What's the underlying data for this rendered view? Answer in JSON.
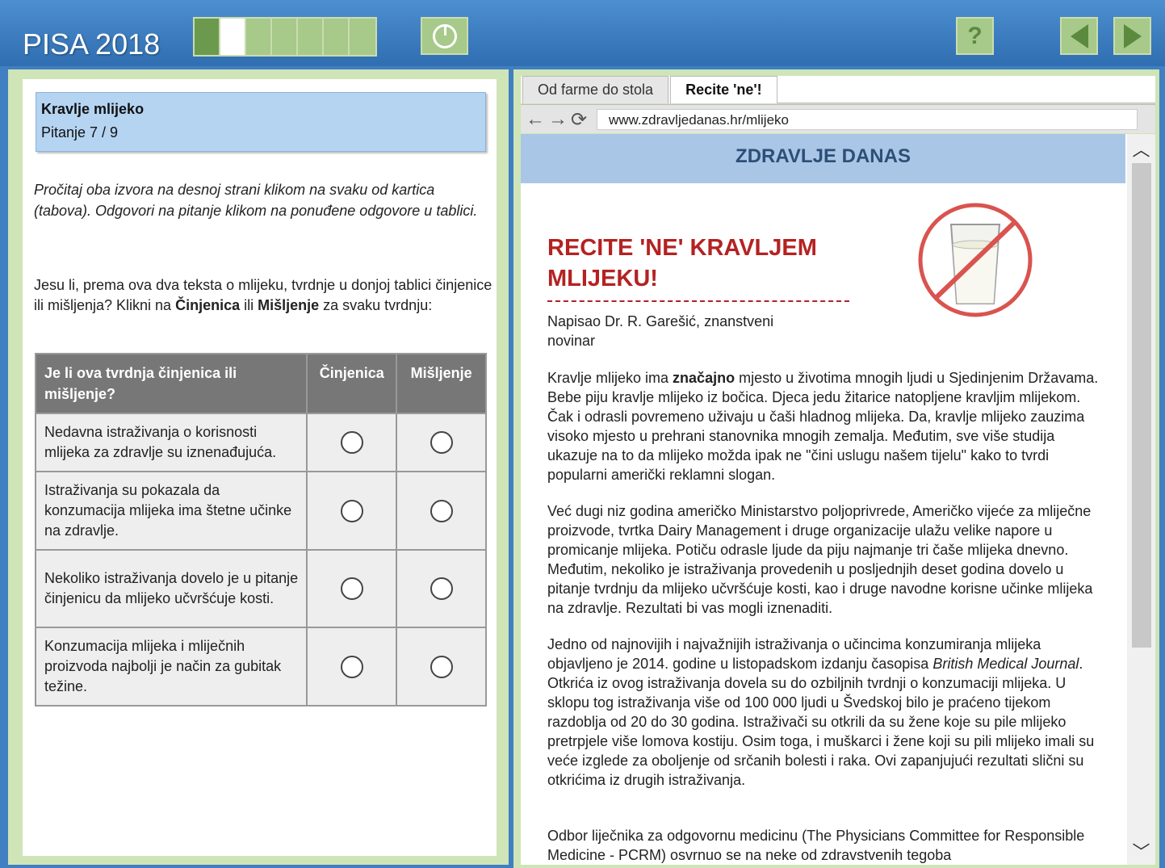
{
  "header": {
    "logo": "PISA 2018",
    "progress": {
      "total": 7,
      "done": 1,
      "current": 2
    },
    "help_label": "?"
  },
  "question_box": {
    "title": "Kravlje mlijeko",
    "subtitle": "Pitanje 7 / 9"
  },
  "instruction": "Pročitaj oba izvora na desnoj strani klikom na svaku od kartica (tabova). Odgovori na pitanje klikom na ponuđene odgovore u tablici.",
  "question": {
    "part1": "Jesu li, prema ova dva teksta o mlijeku, tvrdnje u donjoj tablici činjenice ili mišljenja? Klikni na ",
    "bold1": "Činjenica",
    "part2": " ili ",
    "bold2": "Mišljenje",
    "part3": " za svaku tvrdnju:"
  },
  "table": {
    "headers": [
      "Je li ova tvrdnja činjenica ili mišljenje?",
      "Činjenica",
      "Mišljenje"
    ],
    "rows": [
      "Nedavna istraživanja o korisnosti mlijeka za zdravlje su iznenađujuća.",
      "Istraživanja su pokazala da konzumacija mlijeka ima štetne učinke na zdravlje.",
      "Nekoliko istraživanja dovelo je u pitanje činjenicu da mlijeko učvršćuje kosti.",
      "Konzumacija mlijeka i mliječnih proizvoda najbolji je način za gubitak težine."
    ]
  },
  "browser": {
    "tabs": [
      "Od farme do stola",
      "Recite 'ne'!"
    ],
    "active_tab": 1,
    "url": "www.zdravljedanas.hr/mlijeko",
    "site_name": "ZDRAVLJE DANAS"
  },
  "article": {
    "title": "RECITE 'NE' KRAVLJEM MLIJEKU!",
    "byline": "Napisao Dr. R. Garešić, znanstveni novinar",
    "p1_a": "Kravlje mlijeko ima ",
    "p1_bold": "značajno",
    "p1_b": " mjesto u životima mnogih ljudi u Sjedinjenim Državama. Bebe piju kravlje mlijeko iz bočica. Djeca jedu žitarice natopljene kravljim mlijekom. Čak i odrasli povremeno uživaju u čaši hladnog mlijeka. Da, kravlje mlijeko zauzima visoko mjesto u prehrani stanovnika mnogih zemalja. Međutim, sve više studija ukazuje na to da mlijeko možda ipak ne \"čini uslugu našem tijelu\" kako to tvrdi popularni američki reklamni slogan.",
    "p2": "Već dugi niz godina američko Ministarstvo poljoprivrede, Američko vijeće za mliječne proizvode, tvrtka Dairy Management i druge organizacije ulažu velike napore u promicanje mlijeka. Potiču odrasle ljude da piju najmanje tri čaše mlijeka dnevno. Međutim, nekoliko je istraživanja provedenih u posljednjih deset godina dovelo u pitanje tvrdnju da mlijeko učvršćuje kosti, kao i druge navodne korisne učinke mlijeka na zdravlje. Rezultati bi vas mogli iznenaditi.",
    "p3_a": "Jedno od najnovijih i najvažnijih istraživanja o učincima konzumiranja mlijeka objavljeno je 2014. godine u listopadskom izdanju časopisa ",
    "p3_italic": "British Medical Journal",
    "p3_b": ". Otkrića iz ovog istraživanja dovela su do ozbiljnih tvrdnji o konzumaciji mlijeka. U sklopu tog istraživanja više od 100 000 ljudi u Švedskoj bilo je praćeno tijekom razdoblja od 20 do 30 godina. Istraživači su otkrili da su žene koje su pile mlijeko pretrpjele više lomova kostiju. Osim toga, i muškarci i žene koji su pili mlijeko imali su veće izglede za oboljenje od srčanih bolesti i raka. Ovi zapanjujući rezultati slični su otkrićima iz drugih istraživanja.",
    "p4": "Odbor liječnika za odgovornu medicinu (The Physicians Committee for Responsible Medicine - PCRM) osvrnuo se na neke od zdravstvenih tegoba"
  },
  "colors": {
    "header_blue": "#3f7fc2",
    "panel_green": "#cfe4b7",
    "button_green": "#a7c98a",
    "title_red": "#b42222",
    "banner_blue": "#a9c6e6"
  }
}
